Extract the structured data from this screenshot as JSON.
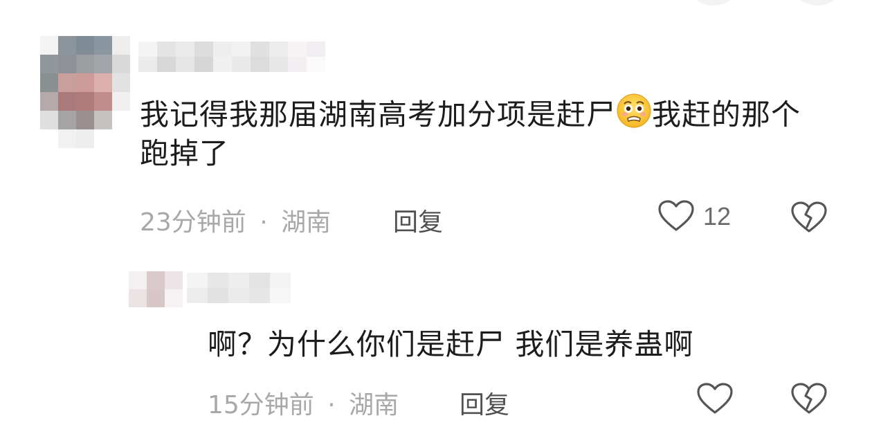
{
  "comments": [
    {
      "text_part1": "我记得我那届湖南高考加分项是赶尸",
      "emoji": "anguished-face",
      "text_part2": "我赶的那个跑掉了",
      "time": "23分钟前",
      "dot": "·",
      "location": "湖南",
      "reply_label": "回复",
      "likes": "12"
    },
    {
      "text": "啊？为什么你们是赶尸 我们是养蛊啊",
      "time": "15分钟前",
      "dot": "·",
      "location": "湖南",
      "reply_label": "回复",
      "likes": ""
    }
  ],
  "icons": {
    "like": "heart-outline-icon",
    "dislike": "broken-heart-icon"
  },
  "colors": {
    "text": "#1c1c1c",
    "meta": "#a8a8a8",
    "icon": "#555555"
  }
}
